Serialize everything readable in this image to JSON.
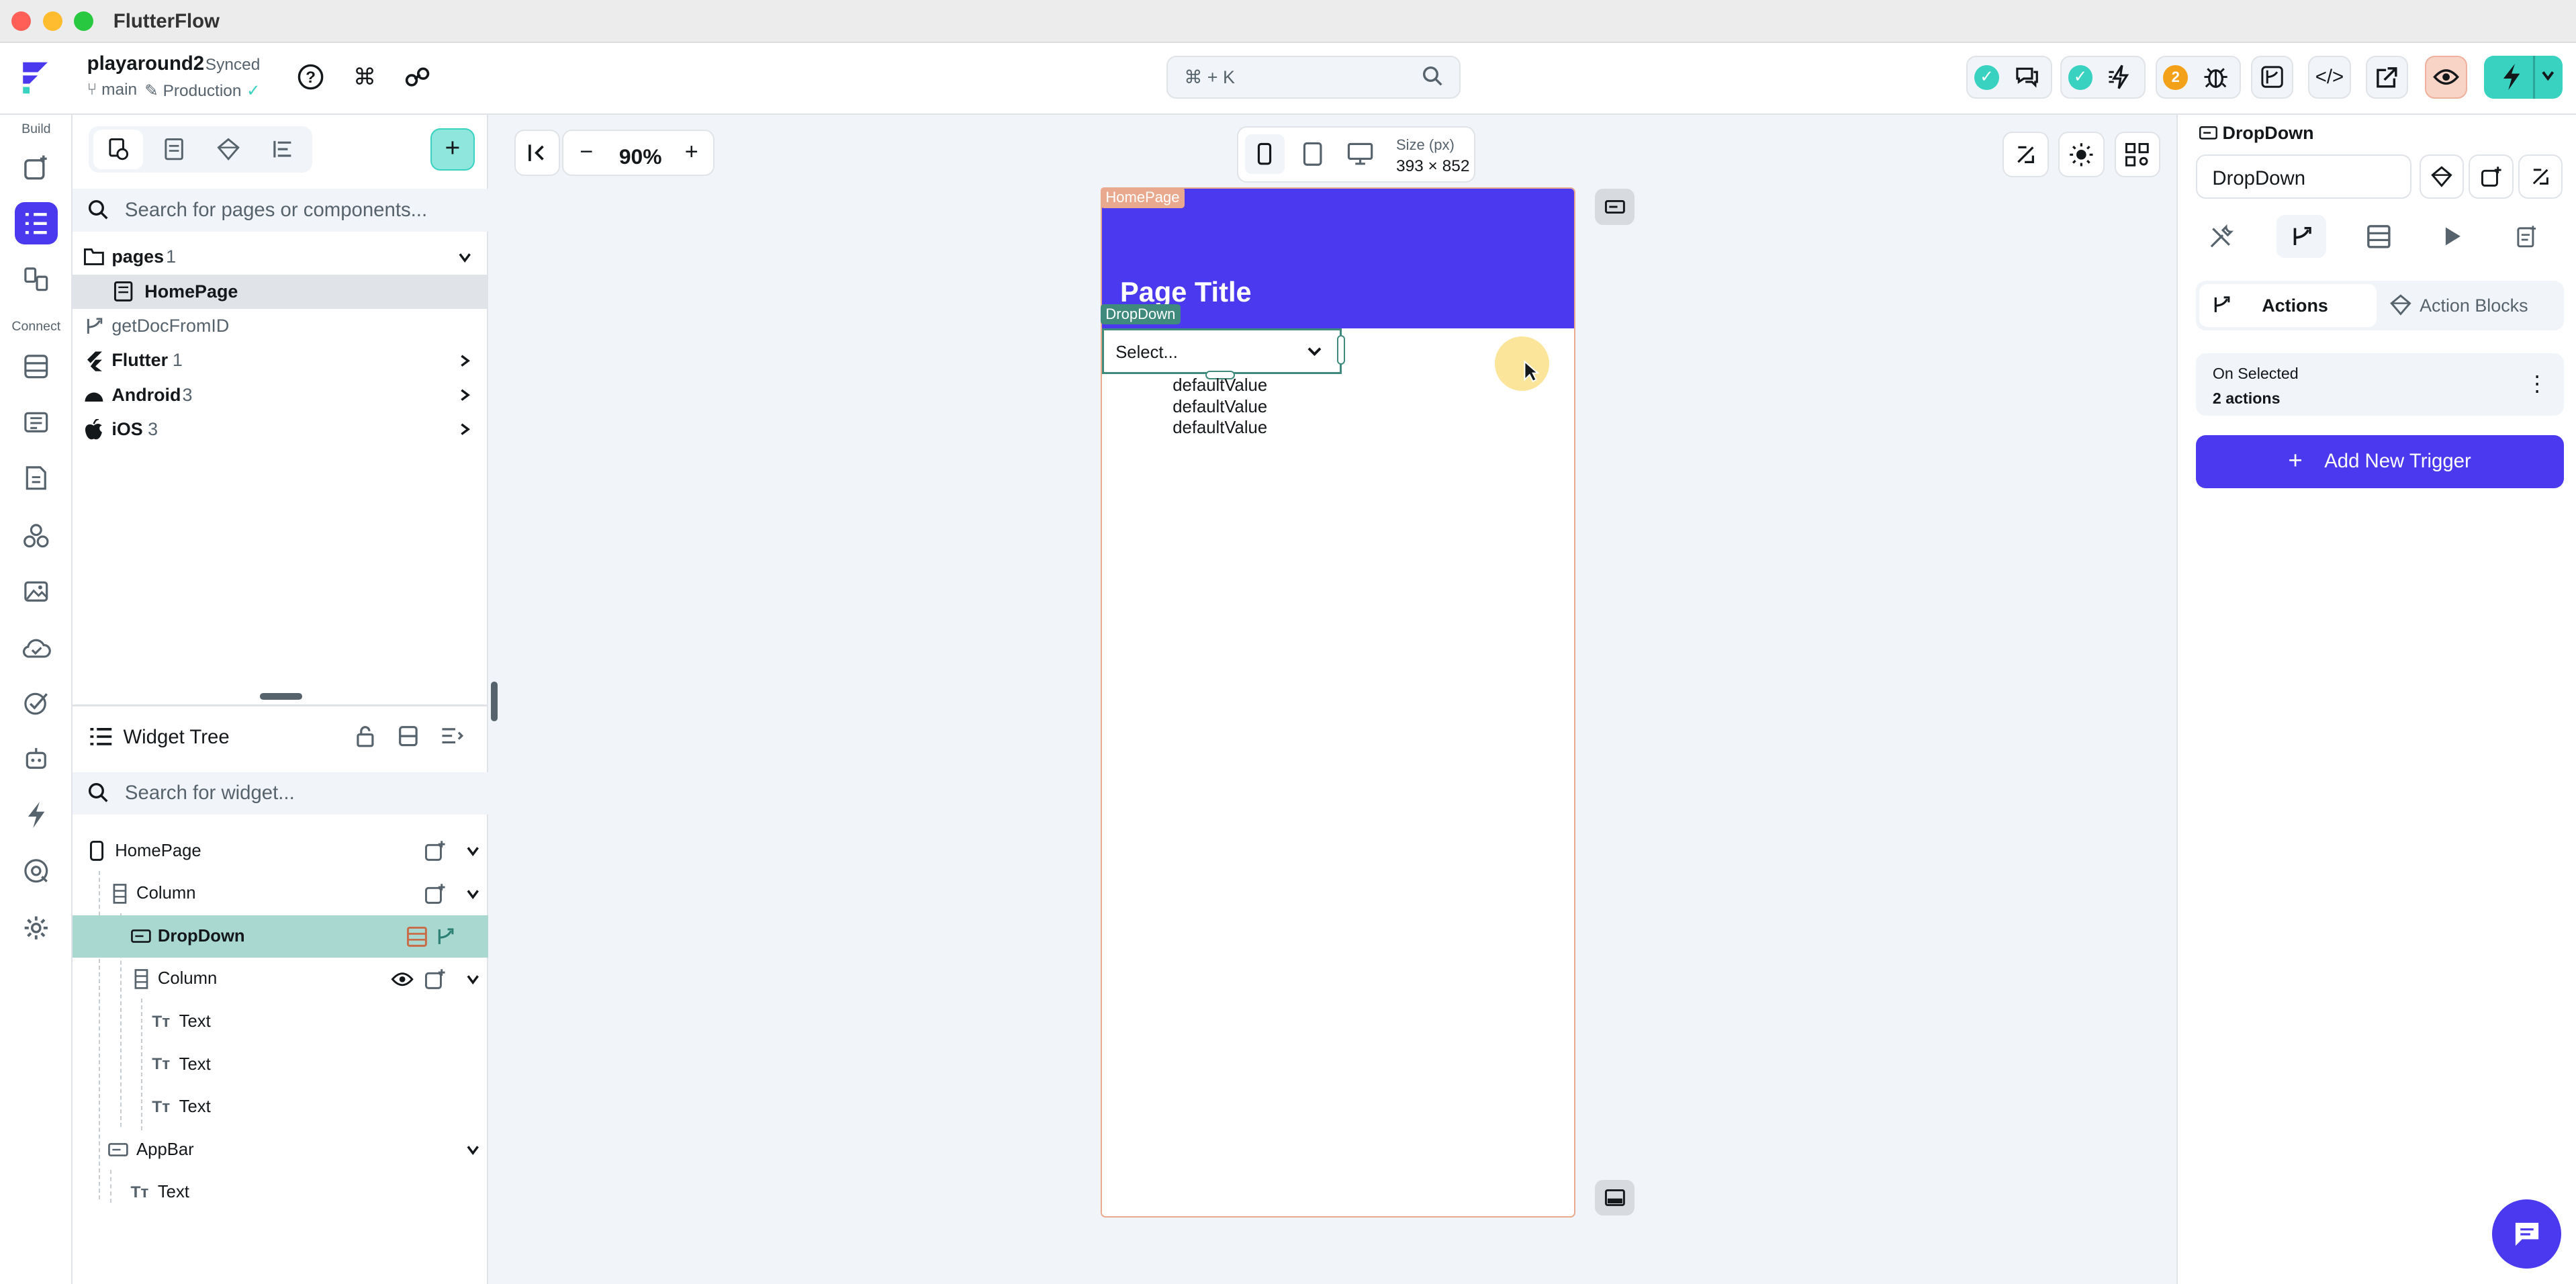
{
  "window": {
    "app_name": "FlutterFlow"
  },
  "project": {
    "name": "playaround2",
    "sync_status": "Synced",
    "branch": "main",
    "environment": "Production"
  },
  "search": {
    "shortcut_hint": "⌘ + K"
  },
  "top_badges": {
    "issues_count": "2"
  },
  "rail": {
    "build_label": "Build",
    "connect_label": "Connect"
  },
  "navigator": {
    "search_placeholder": "Search for pages or components...",
    "items": [
      {
        "label": "pages",
        "count": "1"
      },
      {
        "label": "HomePage"
      },
      {
        "label": "getDocFromID"
      },
      {
        "label": "Flutter",
        "count": "1"
      },
      {
        "label": "Android",
        "count": "3"
      },
      {
        "label": "iOS",
        "count": "3"
      }
    ]
  },
  "widget_tree": {
    "title": "Widget Tree",
    "search_placeholder": "Search for widget...",
    "nodes": [
      {
        "label": "HomePage"
      },
      {
        "label": "Column"
      },
      {
        "label": "DropDown"
      },
      {
        "label": "Column"
      },
      {
        "label": "Text"
      },
      {
        "label": "Text"
      },
      {
        "label": "Text"
      },
      {
        "label": "AppBar"
      },
      {
        "label": "Text"
      }
    ]
  },
  "canvas": {
    "zoom": "90%",
    "size_label": "Size (px)",
    "size_value": "393 × 852",
    "page_tag": "HomePage",
    "dropdown_tag": "DropDown",
    "page_title": "Page Title",
    "dropdown_value": "Select...",
    "values": [
      "defaultValue",
      "defaultValue",
      "defaultValue"
    ]
  },
  "properties": {
    "widget_type": "DropDown",
    "widget_name": "DropDown",
    "tab_actions": "Actions",
    "tab_action_blocks": "Action Blocks",
    "trigger_name": "On Selected",
    "trigger_count": "2 actions",
    "add_trigger_label": "Add New Trigger"
  },
  "colors": {
    "primary": "#4b39ef",
    "secondary": "#39d2c0",
    "selection": "#a9d8d1",
    "page_border": "#e9a98e"
  }
}
